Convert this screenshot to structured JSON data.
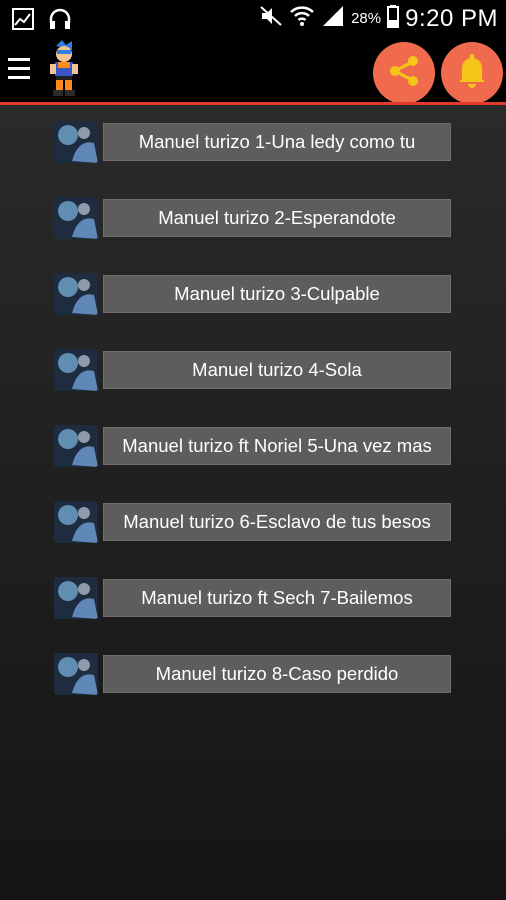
{
  "status_bar": {
    "battery_percent": "28%",
    "time": "9:20 PM",
    "left_icons": [
      "image-icon",
      "headphones-icon"
    ],
    "right_icons": [
      "mute-icon",
      "wifi-icon",
      "signal-icon",
      "battery-icon"
    ]
  },
  "toolbar": {
    "icons": [
      "menu-icon",
      "character-logo-icon",
      "share-icon",
      "bell-icon"
    ],
    "accent_color": "#e23b2d",
    "button_color": "#f06a4d",
    "icon_color": "#f5c518"
  },
  "songs": [
    {
      "label": "Manuel turizo 1-Una ledy como tu"
    },
    {
      "label": "Manuel turizo 2-Esperandote"
    },
    {
      "label": "Manuel turizo 3-Culpable"
    },
    {
      "label": "Manuel turizo 4-Sola"
    },
    {
      "label": "Manuel turizo ft Noriel  5-Una vez mas"
    },
    {
      "label": "Manuel turizo 6-Esclavo de tus besos"
    },
    {
      "label": "Manuel turizo ft Sech 7-Bailemos"
    },
    {
      "label": "Manuel turizo 8-Caso perdido"
    }
  ]
}
